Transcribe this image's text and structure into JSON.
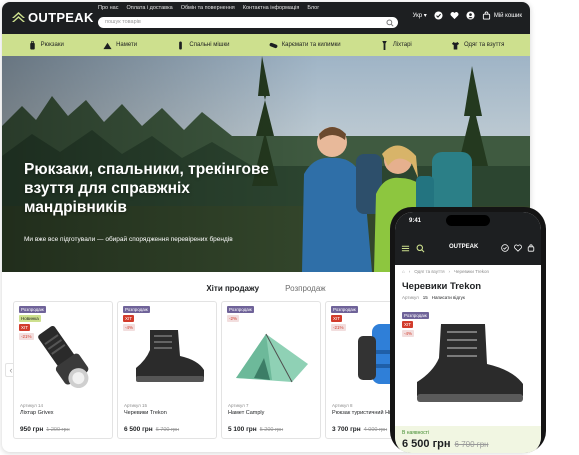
{
  "desktop": {
    "logo": "OUTPEAK",
    "toplinks": [
      "Про нас",
      "Оплата і доставка",
      "Обмін та повернення",
      "Контактна інформація",
      "Блог"
    ],
    "search_placeholder": "пошук товарів",
    "language": "Укр",
    "cart_label": "Мій кошик",
    "categories": [
      {
        "label": "Рюкзаки",
        "icon": "backpack-icon"
      },
      {
        "label": "Намети",
        "icon": "tent-icon"
      },
      {
        "label": "Спальні мішки",
        "icon": "sleeping-bag-icon"
      },
      {
        "label": "Карємати та килимки",
        "icon": "mat-icon"
      },
      {
        "label": "Ліхтарі",
        "icon": "flashlight-icon"
      },
      {
        "label": "Одяг та взуття",
        "icon": "clothing-icon"
      }
    ],
    "hero": {
      "title": "Рюкзаки, спальники, трекінгове взуття для справжніх мандрівників",
      "subtitle": "Ми вже все підготували — обирай спорядження перевірених брендів"
    },
    "tabs": [
      "Хіти продажу",
      "Розпродаж"
    ],
    "products": [
      {
        "badges": [
          "Розпродаж",
          "Новинка",
          "ХІТ",
          "-21%"
        ],
        "article": "Артикул 14",
        "name": "Ліхтар Grivex",
        "price": "950 грн",
        "old_price": "1 200 грн",
        "image": "flashlight"
      },
      {
        "badges": [
          "Розпродаж",
          "ХІТ",
          "-4%"
        ],
        "article": "Артикул 15",
        "name": "Черевики Trekon",
        "price": "6 500 грн",
        "old_price": "6 700 грн",
        "image": "boot"
      },
      {
        "badges": [
          "Розпродаж",
          "-2%"
        ],
        "article": "Артикул 7",
        "name": "Намет Camply",
        "price": "5 100 грн",
        "old_price": "5 200 грн",
        "image": "tent"
      },
      {
        "badges": [
          "Розпродаж",
          "ХІТ",
          "-21%"
        ],
        "article": "Артикул 8",
        "name": "Рюкзак туристичний Hike",
        "price": "3 700 грн",
        "old_price": "4 000 грн",
        "image": "backpack"
      }
    ]
  },
  "phone": {
    "time": "9:41",
    "logo": "OUTPEAK",
    "breadcrumb": [
      "Одяг та взуття",
      "Черевики Trekon"
    ],
    "title": "Черевики Trekon",
    "article_label": "Артикул",
    "article_num": "15",
    "review_link": "Написати відгук",
    "badges": [
      "Розпродаж",
      "ХІТ",
      "-4%"
    ],
    "stock": "В наявності",
    "price": "6 500 грн",
    "old_price": "6 700 грн"
  },
  "colors": {
    "dark": "#1d1f21",
    "accent_green": "#cde08e",
    "sale_purple": "#6f6399",
    "hit_red": "#d23c2c"
  }
}
